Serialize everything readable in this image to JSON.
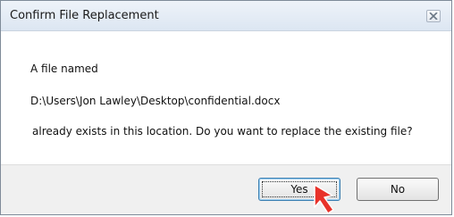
{
  "dialog": {
    "title": "Confirm File Replacement",
    "message_line1": "A file named",
    "file_path": "D:\\Users\\Jon Lawley\\Desktop\\confidential.docx",
    "message_line3": "already exists in this location. Do you want to replace the existing file?",
    "buttons": {
      "yes_label": "Yes",
      "no_label": "No"
    }
  },
  "colors": {
    "cursor": "#e8322a"
  },
  "icons": {
    "close": "close-icon",
    "cursor": "arrow-cursor-icon"
  }
}
